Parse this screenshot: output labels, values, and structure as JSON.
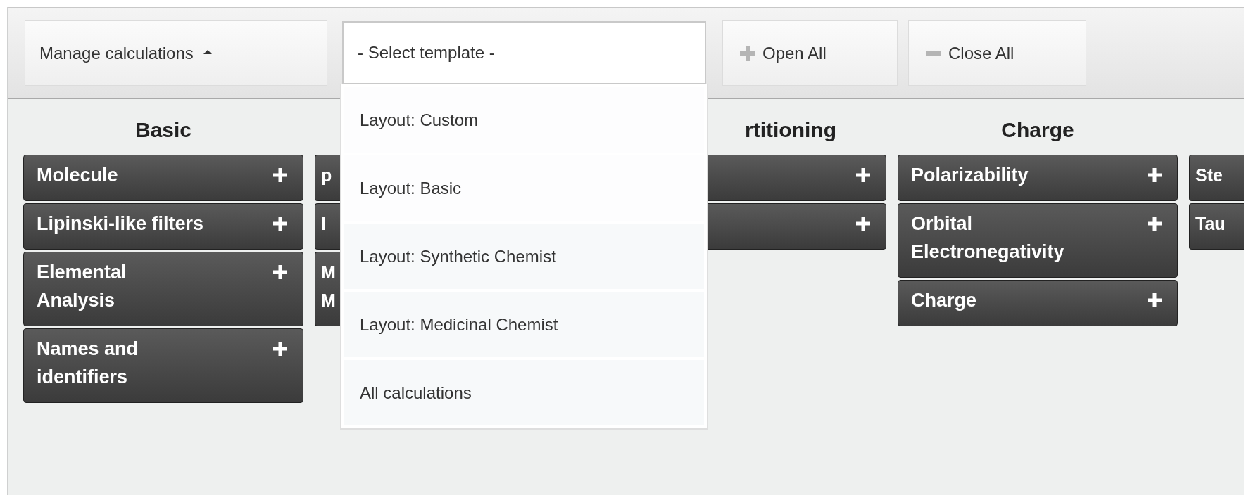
{
  "toolbar": {
    "manage_button": {
      "label": "Manage calculations",
      "expanded": true
    },
    "template_select": {
      "placeholder": "- Select template -",
      "open": true,
      "options": [
        {
          "label": "Layout: Custom"
        },
        {
          "label": "Layout: Basic"
        },
        {
          "label": "Layout: Synthetic Chemist"
        },
        {
          "label": "Layout: Medicinal Chemist"
        },
        {
          "label": "All calculations"
        }
      ]
    },
    "buttons": [
      {
        "kind": "open",
        "label": "Open All"
      },
      {
        "kind": "close",
        "label": "Close All"
      }
    ]
  },
  "columns": [
    {
      "heading": "Basic",
      "items": [
        {
          "kind": "calc",
          "label": "Molecule"
        },
        {
          "kind": "calc",
          "label": "Lipinski-like filters"
        },
        {
          "kind": "calc",
          "label": "Elemental\nAnalysis"
        },
        {
          "kind": "calc",
          "label": "Names and\nidentifiers"
        }
      ]
    },
    {
      "items": [
        {
          "kind": "cut",
          "label": "p"
        },
        {
          "kind": "cut",
          "label": "I"
        },
        {
          "kind": "cut",
          "label": "M\nM"
        }
      ]
    },
    {
      "heading": "rtitioning",
      "items": [
        {
          "kind": "calc"
        },
        {
          "kind": "calc"
        }
      ]
    },
    {
      "heading": "Charge",
      "items": [
        {
          "kind": "calc",
          "label": "Polarizability"
        },
        {
          "kind": "calc",
          "label": "Orbital\nElectronegativity"
        },
        {
          "kind": "calc",
          "label": "Charge"
        }
      ]
    },
    {
      "items": [
        {
          "kind": "cut",
          "label": "Ste"
        },
        {
          "kind": "cut",
          "label": "Tau"
        }
      ]
    }
  ]
}
